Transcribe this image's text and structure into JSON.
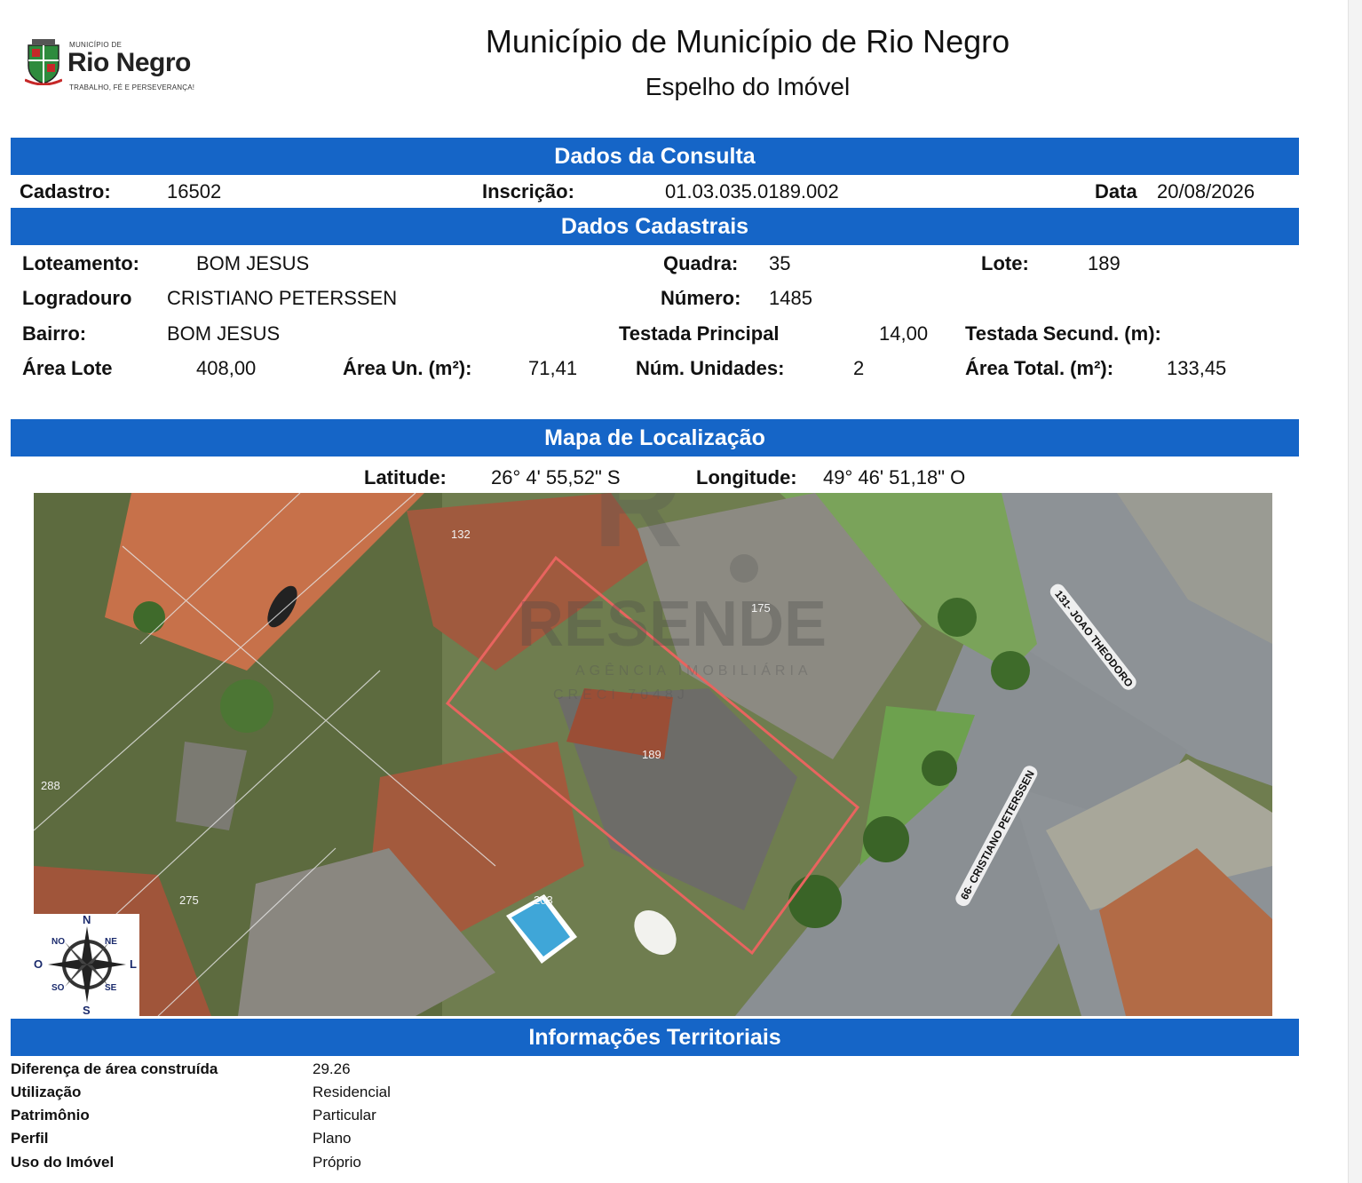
{
  "header": {
    "logo": {
      "small_text": "MUNICÍPIO DE",
      "brand": "Rio Negro",
      "motto": "TRABALHO, FÉ E PERSEVERANÇA!"
    },
    "title": "Município de Município de Rio Negro",
    "subtitle": "Espelho do Imóvel"
  },
  "consulta": {
    "heading": "Dados da Consulta",
    "cadastro_label": "Cadastro:",
    "cadastro_value": "16502",
    "inscricao_label": "Inscrição:",
    "inscricao_value": "01.03.035.0189.002",
    "data_label": "Data",
    "data_value": "20/08/2026"
  },
  "cadastrais": {
    "heading": "Dados Cadastrais",
    "loteamento_label": "Loteamento:",
    "loteamento_value": "BOM JESUS",
    "quadra_label": "Quadra:",
    "quadra_value": "35",
    "lote_label": "Lote:",
    "lote_value": "189",
    "logradouro_label": "Logradouro",
    "logradouro_value": "CRISTIANO PETERSSEN",
    "numero_label": "Número:",
    "numero_value": "1485",
    "bairro_label": "Bairro:",
    "bairro_value": "BOM JESUS",
    "testada_principal_label": "Testada Principal",
    "testada_principal_value": "14,00",
    "testada_secund_label": "Testada Secund. (m):",
    "area_lote_label": "Área Lote",
    "area_lote_value": "408,00",
    "area_un_label": "Área Un. (m²):",
    "area_un_value": "71,41",
    "num_unidades_label": "Núm. Unidades:",
    "num_unidades_value": "2",
    "area_total_label": "Área Total. (m²):",
    "area_total_value": "133,45"
  },
  "mapa": {
    "heading": "Mapa de Localização",
    "latitude_label": "Latitude:",
    "latitude_value": "26° 4' 55,52\" S",
    "longitude_label": "Longitude:",
    "longitude_value": "49° 46' 51,18\" O",
    "lot_numbers": [
      "132",
      "175",
      "189",
      "288",
      "275",
      "203"
    ],
    "street_labels": [
      "131- JOAO THEODORO",
      "66- CRISTIANO PETERSSEN"
    ],
    "watermark": {
      "brand": "RESENDE",
      "tagline": "AGÊNCIA IMOBILIÁRIA",
      "creci": "CRECI 7048J"
    },
    "compass": {
      "n": "N",
      "s": "S",
      "l": "L",
      "o": "O",
      "ne": "NE",
      "no": "NO",
      "se": "SE",
      "so": "SO"
    },
    "lot_outline_color": "#e8645f"
  },
  "territoriais": {
    "heading": "Informações Territoriais",
    "rows": [
      {
        "label": "Diferença de área construída",
        "value": "29.26"
      },
      {
        "label": "Utilização",
        "value": "Residencial"
      },
      {
        "label": "Patrimônio",
        "value": "Particular"
      },
      {
        "label": "Perfil",
        "value": "Plano"
      },
      {
        "label": "Uso do Imóvel",
        "value": "Próprio"
      }
    ]
  },
  "colors": {
    "bar": "#1565c7"
  }
}
